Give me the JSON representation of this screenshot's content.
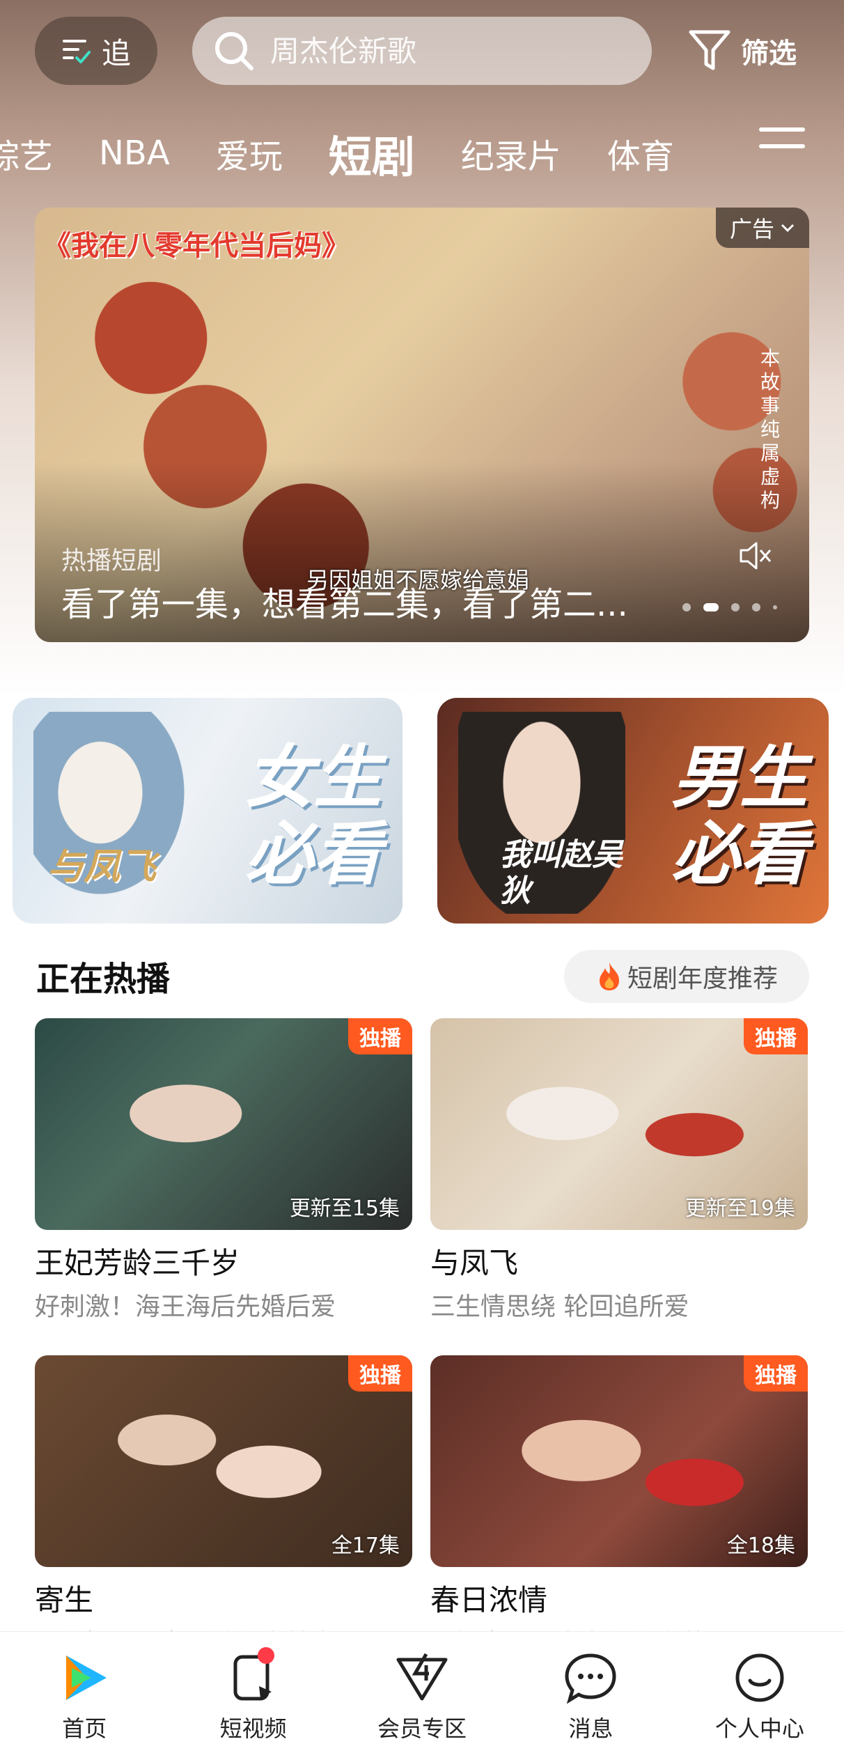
{
  "topbar": {
    "follow_label": "追",
    "search_placeholder": "周杰伦新歌",
    "filter_label": "筛选"
  },
  "tabs": [
    {
      "label": "综艺",
      "active": false
    },
    {
      "label": "NBA",
      "active": false
    },
    {
      "label": "爱玩",
      "active": false
    },
    {
      "label": "短剧",
      "active": true
    },
    {
      "label": "纪录片",
      "active": false
    },
    {
      "label": "体育",
      "active": false
    }
  ],
  "banner": {
    "drama_title": "《我在八零年代当后妈》",
    "ad_label": "广告",
    "side_note": "本故事纯属虚构",
    "subtitle": "另因姐姐不愿嫁给意娟",
    "tag": "热播短剧",
    "headline": "看了第一集，想看第二集，看了第二...",
    "slide_count": 5,
    "active_slide": 2
  },
  "promos": {
    "girls_line1": "女生",
    "girls_line2": "必看",
    "girls_poster_text": "与凤飞",
    "boys_line1": "男生",
    "boys_line2": "必看",
    "boys_poster_text": "我叫赵吴狄"
  },
  "section": {
    "title": "正在热播",
    "recommend_label": "短剧年度推荐"
  },
  "cards": [
    {
      "title": "王妃芳龄三千岁",
      "subtitle": "好刺激！海王海后先婚后爱",
      "badge": "独播",
      "episodes": "更新至15集"
    },
    {
      "title": "与凤飞",
      "subtitle": "三生情思绕 轮回追所爱",
      "badge": "独播",
      "episodes": "更新至19集"
    },
    {
      "title": "寄生",
      "subtitle": "霸总把职业女仆做亲妻替身？",
      "badge": "独播",
      "episodes": "全17集"
    },
    {
      "title": "春日浓情",
      "subtitle": "妩媚女谍以身为饵钓少帅",
      "badge": "独播",
      "episodes": "全18集"
    }
  ],
  "bottom_nav": [
    {
      "label": "首页",
      "icon": "home-play-icon"
    },
    {
      "label": "短视频",
      "icon": "short-video-icon"
    },
    {
      "label": "会员专区",
      "icon": "vip-icon"
    },
    {
      "label": "消息",
      "icon": "message-icon"
    },
    {
      "label": "个人中心",
      "icon": "profile-icon"
    }
  ],
  "colors": {
    "accent": "#ff5a1f",
    "notification": "#ff3b47",
    "banner_title": "#e33a2e"
  }
}
